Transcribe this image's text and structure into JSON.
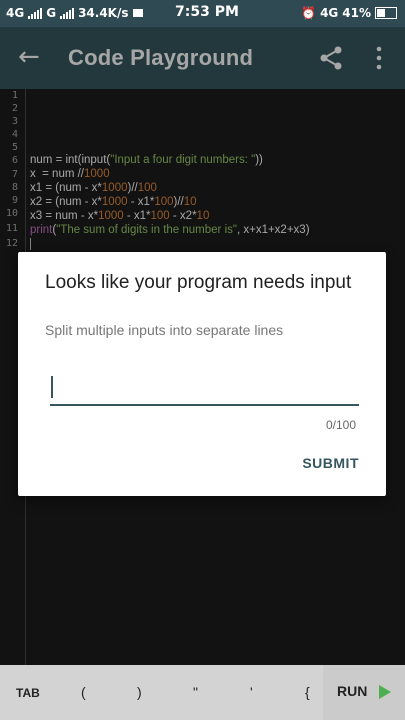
{
  "status_bar": {
    "network_1": "4G",
    "network_2": "G",
    "speed": "34.4K/s",
    "time": "7:53 PM",
    "network_3": "4G",
    "battery": "41%"
  },
  "app_bar": {
    "title": "Code Playground",
    "back_icon": "arrow-back-icon",
    "share_icon": "share-icon",
    "more_icon": "more-vert-icon"
  },
  "editor": {
    "line_numbers": [
      "1",
      "2",
      "3",
      "4",
      "5",
      "6",
      "7",
      "8",
      "9",
      "10",
      "11",
      "12"
    ],
    "lines": {
      "l6": {
        "p1": "num = int(input(",
        "s1": "\"Input a four digit numbers: \"",
        "p2": "))"
      },
      "l7": {
        "p1": "x  = num //",
        "n1": "1000"
      },
      "l8": {
        "p1": "x1 = (num - x*",
        "n1": "1000",
        "p2": ")//",
        "n2": "100"
      },
      "l9": {
        "p1": "x2 = (num - x*",
        "n1": "1000",
        "p2": " - x1*",
        "n2": "100",
        "p3": ")//",
        "n3": "10"
      },
      "l10": {
        "p1": "x3 = num - x*",
        "n1": "1000",
        "p2": " - x1*",
        "n2": "100",
        "p3": " - x2*",
        "n3": "10"
      },
      "l11": {
        "kw": "print",
        "p1": "(",
        "s1": "\"The sum of digits in the number is\"",
        "p2": ", x+x1+x2+x3)"
      }
    }
  },
  "dialog": {
    "title": "Looks like your program needs input",
    "subtitle": "Split multiple inputs into separate lines",
    "input_value": "",
    "counter": "0/100",
    "submit_label": "SUBMIT"
  },
  "keys": {
    "tab": "TAB",
    "paren_open": "(",
    "paren_close": ")",
    "double_quote": "\"",
    "single_quote": "'",
    "brace_open": "{",
    "run_label": "RUN",
    "run_icon": "play-icon"
  },
  "colors": {
    "primary": "#36575f",
    "status": "#2f4a52",
    "string": "#9acd69",
    "number": "#e58a3c",
    "keyword": "#c979c8",
    "run_green": "#4caf50"
  }
}
